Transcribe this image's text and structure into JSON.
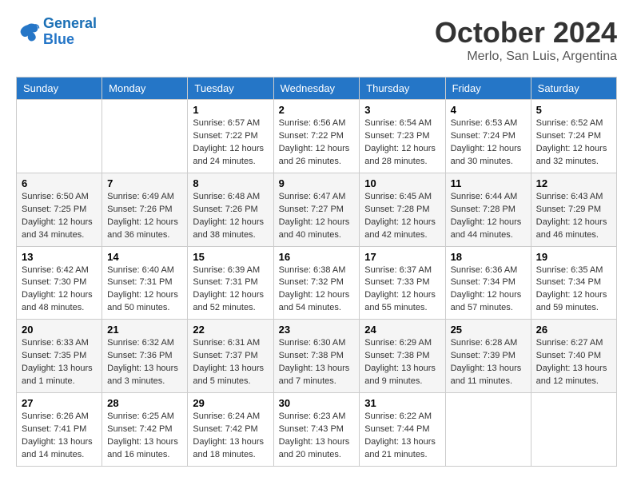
{
  "logo": {
    "line1": "General",
    "line2": "Blue"
  },
  "title": "October 2024",
  "subtitle": "Merlo, San Luis, Argentina",
  "days_of_week": [
    "Sunday",
    "Monday",
    "Tuesday",
    "Wednesday",
    "Thursday",
    "Friday",
    "Saturday"
  ],
  "weeks": [
    [
      {
        "day": "",
        "info": ""
      },
      {
        "day": "",
        "info": ""
      },
      {
        "day": "1",
        "info": "Sunrise: 6:57 AM\nSunset: 7:22 PM\nDaylight: 12 hours and 24 minutes."
      },
      {
        "day": "2",
        "info": "Sunrise: 6:56 AM\nSunset: 7:22 PM\nDaylight: 12 hours and 26 minutes."
      },
      {
        "day": "3",
        "info": "Sunrise: 6:54 AM\nSunset: 7:23 PM\nDaylight: 12 hours and 28 minutes."
      },
      {
        "day": "4",
        "info": "Sunrise: 6:53 AM\nSunset: 7:24 PM\nDaylight: 12 hours and 30 minutes."
      },
      {
        "day": "5",
        "info": "Sunrise: 6:52 AM\nSunset: 7:24 PM\nDaylight: 12 hours and 32 minutes."
      }
    ],
    [
      {
        "day": "6",
        "info": "Sunrise: 6:50 AM\nSunset: 7:25 PM\nDaylight: 12 hours and 34 minutes."
      },
      {
        "day": "7",
        "info": "Sunrise: 6:49 AM\nSunset: 7:26 PM\nDaylight: 12 hours and 36 minutes."
      },
      {
        "day": "8",
        "info": "Sunrise: 6:48 AM\nSunset: 7:26 PM\nDaylight: 12 hours and 38 minutes."
      },
      {
        "day": "9",
        "info": "Sunrise: 6:47 AM\nSunset: 7:27 PM\nDaylight: 12 hours and 40 minutes."
      },
      {
        "day": "10",
        "info": "Sunrise: 6:45 AM\nSunset: 7:28 PM\nDaylight: 12 hours and 42 minutes."
      },
      {
        "day": "11",
        "info": "Sunrise: 6:44 AM\nSunset: 7:28 PM\nDaylight: 12 hours and 44 minutes."
      },
      {
        "day": "12",
        "info": "Sunrise: 6:43 AM\nSunset: 7:29 PM\nDaylight: 12 hours and 46 minutes."
      }
    ],
    [
      {
        "day": "13",
        "info": "Sunrise: 6:42 AM\nSunset: 7:30 PM\nDaylight: 12 hours and 48 minutes."
      },
      {
        "day": "14",
        "info": "Sunrise: 6:40 AM\nSunset: 7:31 PM\nDaylight: 12 hours and 50 minutes."
      },
      {
        "day": "15",
        "info": "Sunrise: 6:39 AM\nSunset: 7:31 PM\nDaylight: 12 hours and 52 minutes."
      },
      {
        "day": "16",
        "info": "Sunrise: 6:38 AM\nSunset: 7:32 PM\nDaylight: 12 hours and 54 minutes."
      },
      {
        "day": "17",
        "info": "Sunrise: 6:37 AM\nSunset: 7:33 PM\nDaylight: 12 hours and 55 minutes."
      },
      {
        "day": "18",
        "info": "Sunrise: 6:36 AM\nSunset: 7:34 PM\nDaylight: 12 hours and 57 minutes."
      },
      {
        "day": "19",
        "info": "Sunrise: 6:35 AM\nSunset: 7:34 PM\nDaylight: 12 hours and 59 minutes."
      }
    ],
    [
      {
        "day": "20",
        "info": "Sunrise: 6:33 AM\nSunset: 7:35 PM\nDaylight: 13 hours and 1 minute."
      },
      {
        "day": "21",
        "info": "Sunrise: 6:32 AM\nSunset: 7:36 PM\nDaylight: 13 hours and 3 minutes."
      },
      {
        "day": "22",
        "info": "Sunrise: 6:31 AM\nSunset: 7:37 PM\nDaylight: 13 hours and 5 minutes."
      },
      {
        "day": "23",
        "info": "Sunrise: 6:30 AM\nSunset: 7:38 PM\nDaylight: 13 hours and 7 minutes."
      },
      {
        "day": "24",
        "info": "Sunrise: 6:29 AM\nSunset: 7:38 PM\nDaylight: 13 hours and 9 minutes."
      },
      {
        "day": "25",
        "info": "Sunrise: 6:28 AM\nSunset: 7:39 PM\nDaylight: 13 hours and 11 minutes."
      },
      {
        "day": "26",
        "info": "Sunrise: 6:27 AM\nSunset: 7:40 PM\nDaylight: 13 hours and 12 minutes."
      }
    ],
    [
      {
        "day": "27",
        "info": "Sunrise: 6:26 AM\nSunset: 7:41 PM\nDaylight: 13 hours and 14 minutes."
      },
      {
        "day": "28",
        "info": "Sunrise: 6:25 AM\nSunset: 7:42 PM\nDaylight: 13 hours and 16 minutes."
      },
      {
        "day": "29",
        "info": "Sunrise: 6:24 AM\nSunset: 7:42 PM\nDaylight: 13 hours and 18 minutes."
      },
      {
        "day": "30",
        "info": "Sunrise: 6:23 AM\nSunset: 7:43 PM\nDaylight: 13 hours and 20 minutes."
      },
      {
        "day": "31",
        "info": "Sunrise: 6:22 AM\nSunset: 7:44 PM\nDaylight: 13 hours and 21 minutes."
      },
      {
        "day": "",
        "info": ""
      },
      {
        "day": "",
        "info": ""
      }
    ]
  ]
}
